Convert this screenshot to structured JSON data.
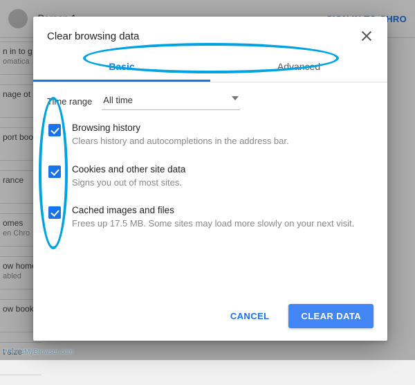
{
  "bg": {
    "person": "Person 1",
    "signin": "SIGN IN TO CHRO",
    "rows": [
      {
        "a": "n in to g",
        "b": "omatica"
      },
      {
        "a": "nage ot",
        "b": ""
      },
      {
        "a": "port boo",
        "b": ""
      },
      {
        "a": "rance",
        "b": ""
      },
      {
        "a": "omes",
        "b": "en Chro"
      },
      {
        "a": "ow home",
        "b": "abled"
      },
      {
        "a": "ow book",
        "b": ""
      },
      {
        "a": "t size",
        "b": ""
      }
    ]
  },
  "dialog": {
    "title": "Clear browsing data",
    "tabs": {
      "basic": "Basic",
      "advanced": "Advanced"
    },
    "timerange_label": "Time range",
    "timerange_value": "All time",
    "options": [
      {
        "title": "Browsing history",
        "sub": "Clears history and autocompletions in the address bar."
      },
      {
        "title": "Cookies and other site data",
        "sub": "Signs you out of most sites."
      },
      {
        "title": "Cached images and files",
        "sub": "Frees up 17.5 MB. Some sites may load more slowly on your next visit."
      }
    ],
    "cancel": "CANCEL",
    "clear": "CLEAR DATA"
  },
  "watermark": "WhatIsMyBrowser.com"
}
